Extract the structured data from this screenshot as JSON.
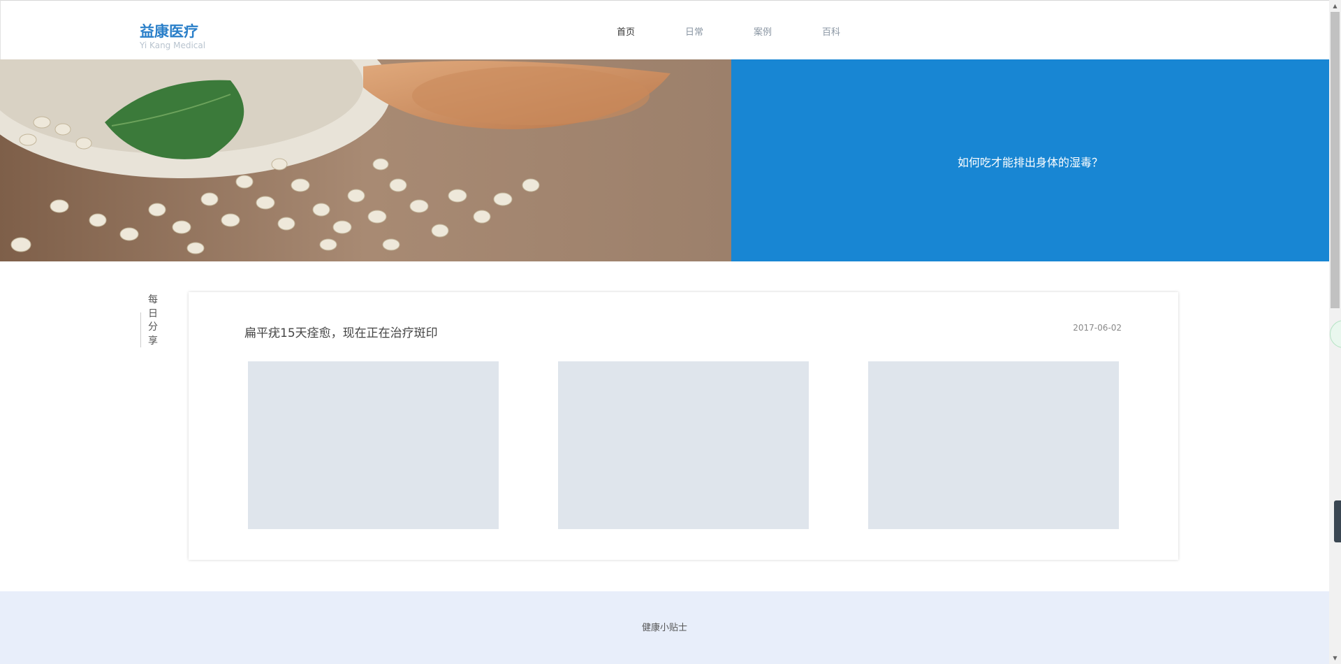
{
  "header": {
    "logo_cn": "益康医疗",
    "logo_en": "Yi Kang Medical",
    "nav": [
      {
        "label": "首页",
        "active": true
      },
      {
        "label": "日常",
        "active": false
      },
      {
        "label": "案例",
        "active": false
      },
      {
        "label": "百科",
        "active": false
      }
    ]
  },
  "hero": {
    "title": "如何吃才能排出身体的湿毒？"
  },
  "daily": {
    "side_label": "每\n日\n分\n享",
    "post_title": "扁平疣15天痊愈，现在正在治疗斑印",
    "post_date": "2017-06-02"
  },
  "footer": {
    "label": "健康小贴士"
  },
  "colors": {
    "brand": "#2a7fc9",
    "hero_blue": "#1886d3",
    "placeholder": "#dfe5ec",
    "footer_bg": "#e8eefa"
  }
}
